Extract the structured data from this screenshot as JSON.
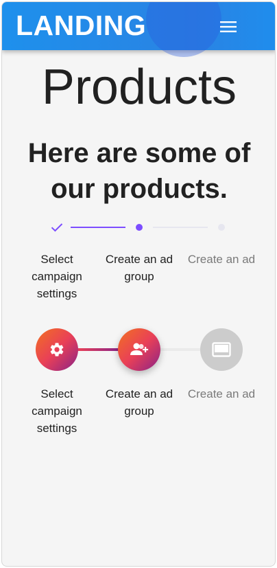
{
  "header": {
    "brand": "LANDING",
    "menu_icon": "hamburger-menu-icon"
  },
  "main": {
    "title": "Products",
    "subtitle": "Here are some of our products."
  },
  "stepper_basic": {
    "steps": [
      {
        "label": "Select campaign settings",
        "state": "completed",
        "icon": "check-icon"
      },
      {
        "label": "Create an ad group",
        "state": "active",
        "icon": "dot-icon"
      },
      {
        "label": "Create an ad",
        "state": "disabled",
        "icon": "dot-icon"
      }
    ],
    "colors": {
      "accent": "#7c4dff",
      "inactive": "#e6e6ef"
    }
  },
  "stepper_custom": {
    "steps": [
      {
        "label": "Select campaign settings",
        "state": "completed",
        "icon": "settings-gear-icon"
      },
      {
        "label": "Create an ad group",
        "state": "active",
        "icon": "group-add-icon"
      },
      {
        "label": "Create an ad",
        "state": "disabled",
        "icon": "video-label-icon"
      }
    ],
    "colors": {
      "gradient_start": "#f27121",
      "gradient_mid": "#e94057",
      "gradient_end": "#8a2387",
      "disabled": "#cccccc"
    }
  }
}
